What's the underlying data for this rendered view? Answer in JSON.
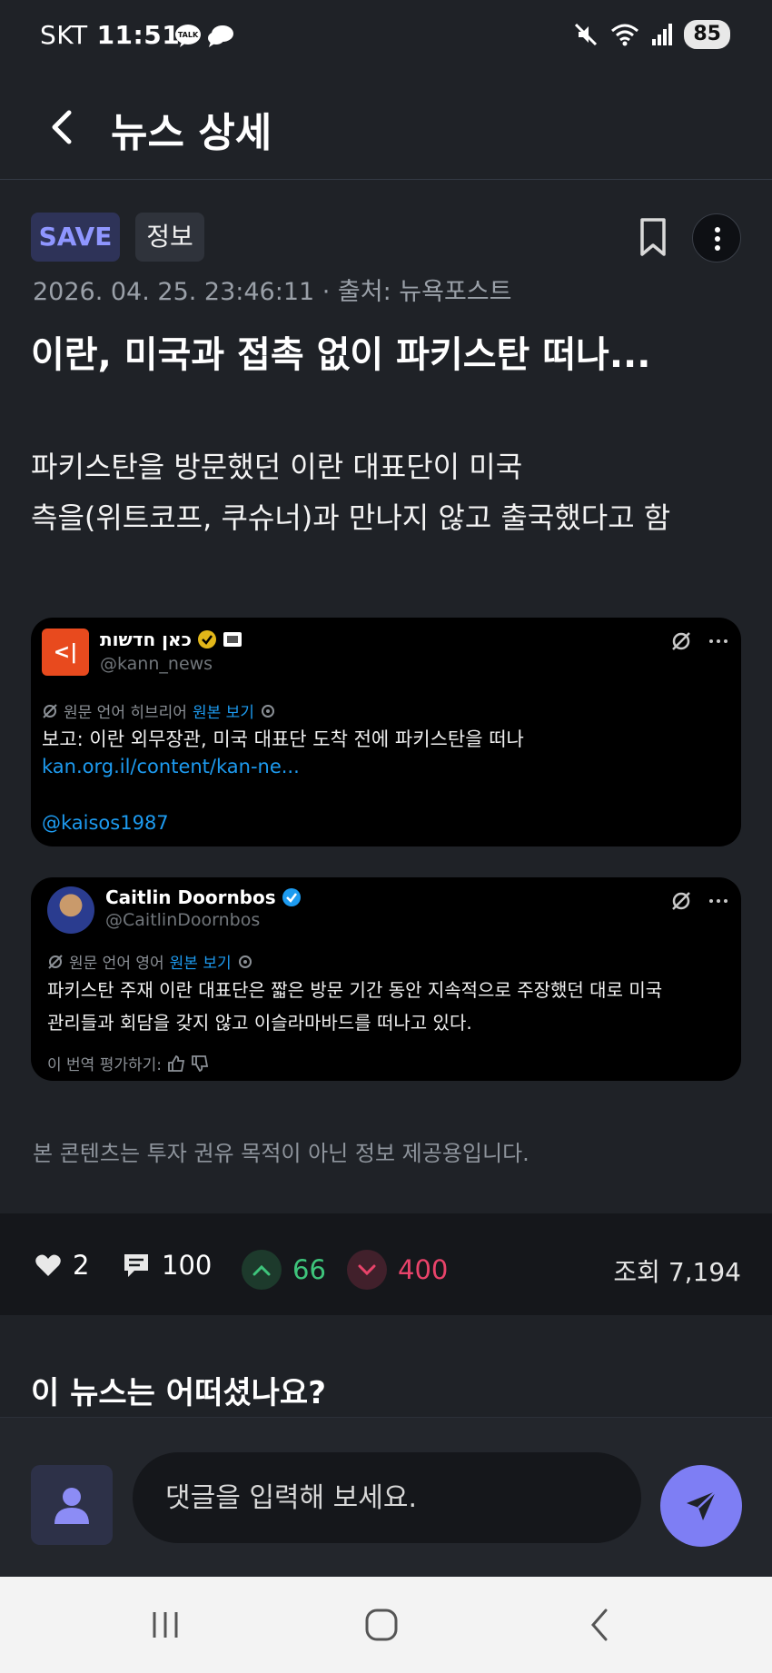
{
  "status_bar": {
    "carrier": "SKT",
    "time": "11:51",
    "battery": "85",
    "talk_badge": "TALK"
  },
  "header": {
    "title": "뉴스 상세"
  },
  "article": {
    "tags": [
      "SAVE",
      "정보"
    ],
    "date_source": "2026. 04. 25. 23:46:11 · 출처: 뉴욕포스트",
    "headline": "이란, 미국과 접촉 없이 파키스탄 떠나...",
    "summary_line1": "파키스탄을 방문했던 이란 대표단이 미국",
    "summary_line2": "측을(위트코프, 쿠슈너)과 만나지 않고 출국했다고 함",
    "disclaimer": "본 콘텐츠는 투자 권유 목적이 아닌 정보 제공용입니다."
  },
  "tweets": [
    {
      "name": "כאן חדשות",
      "handle": "@kann_news",
      "avatar_text": "<|",
      "translate_prefix": "원문 언어 히브리어",
      "translate_link": "원본 보기",
      "text": "보고: 이란 외무장관, 미국 대표단 도착 전에 파키스탄을 떠나",
      "url": "kan.org.il/content/kan-ne...",
      "mention": "@kaisos1987"
    },
    {
      "name": "Caitlin Doornbos",
      "handle": "@CaitlinDoornbos",
      "translate_prefix": "원문 언어 영어",
      "translate_link": "원본 보기",
      "text_line1": "파키스탄 주재 이란 대표단은 짧은 방문 기간 동안 지속적으로 주장했던 대로 미국",
      "text_line2": "관리들과 회담을 갖지 않고 이슬라마바드를 떠나고 있다.",
      "rate_label": "이 번역 평가하기:"
    }
  ],
  "stats": {
    "likes": "2",
    "comments": "100",
    "upvotes": "66",
    "downvotes": "400",
    "views": "조회 7,194"
  },
  "reaction": {
    "title": "이 뉴스는 어떠셨나요?"
  },
  "composer": {
    "placeholder": "댓글을 입력해 보세요."
  },
  "colors": {
    "accent": "#7e7ef4",
    "save_tag": "#8f96ff",
    "up": "#3ec47b",
    "down": "#e8436a",
    "link": "#1d9bf0"
  }
}
